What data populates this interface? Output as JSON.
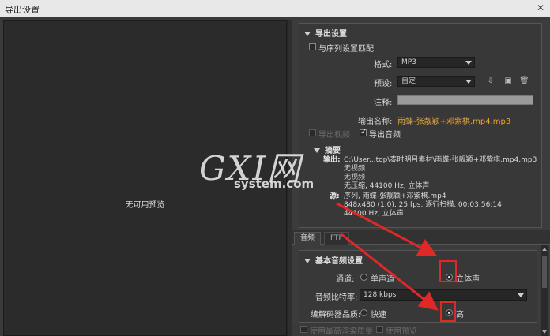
{
  "window": {
    "title": "导出设置",
    "close_glyph": "✕"
  },
  "preview": {
    "no_preview": "无可用预览"
  },
  "export_settings": {
    "section_title": "导出设置",
    "match_sequence": "与序列设置匹配",
    "format_label": "格式:",
    "format_value": "MP3",
    "preset_label": "预设:",
    "preset_value": "自定",
    "comments_label": "注释:",
    "comments_value": "",
    "output_name_label": "输出名称:",
    "output_name_value": "雨蝶-张靓颖+邓紫棋.mp4.mp3",
    "export_video": "导出视频",
    "export_audio": "导出音频",
    "icons": [
      "save-preset-icon",
      "import-preset-icon",
      "delete-preset-icon"
    ]
  },
  "summary": {
    "title": "摘要",
    "output_label": "输出:",
    "output_path": "C:\\User...top\\泰时明月素材\\雨蝶-张靓颖+邓紫棋.mp4.mp3",
    "output_line2": "无视频",
    "output_line3": "无视频",
    "output_line4": "无压缩, 44100 Hz, 立体声",
    "source_label": "源:",
    "source_line1": "序列, 雨蝶-张靓颖+邓紫棋.mp4",
    "source_line2": "848x480 (1.0), 25 fps, 逐行扫描, 00:03:56:14",
    "source_line3": "44100 Hz, 立体声"
  },
  "watermark": {
    "big": "GXI网",
    "small": "system.com"
  },
  "tabs": [
    {
      "label": "音频",
      "active": true
    },
    {
      "label": "FTP",
      "active": false
    }
  ],
  "audio_settings": {
    "section_title": "基本音频设置",
    "channels_label": "通道:",
    "mono": "单声道",
    "stereo": "立体声",
    "selected_channel": "stereo",
    "bitrate_label": "音频比特率:",
    "bitrate_value": "128 kbps",
    "quality_label": "编解码器品质:",
    "quality_fast": "快速",
    "quality_high": "高",
    "selected_quality": "high"
  },
  "bottom": {
    "max_render": "使用最高渲染质量",
    "use_preview": "使用预览"
  },
  "colors": {
    "accent_link": "#e2a23a",
    "annotation_red": "#e02828"
  }
}
